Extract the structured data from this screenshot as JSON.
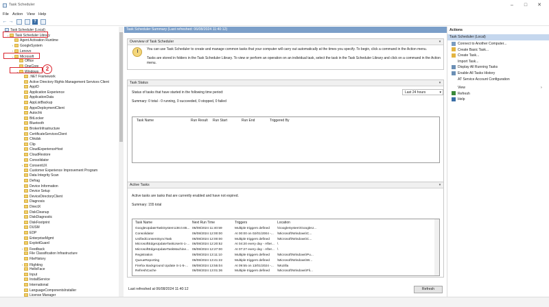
{
  "window": {
    "title": "Task Scheduler"
  },
  "menu": [
    "File",
    "Action",
    "View",
    "Help"
  ],
  "tree": {
    "rows": [
      {
        "label": "Task Scheduler (Local)",
        "indent": 0,
        "arrow": ""
      },
      {
        "label": "Task Scheduler Library",
        "indent": 1,
        "arrow": "v"
      },
      {
        "label": "Agent Activation Runtime",
        "indent": 2,
        "arrow": ""
      },
      {
        "label": "GoogleSystem",
        "indent": 2,
        "arrow": ">"
      },
      {
        "label": "Lenovo",
        "indent": 2,
        "arrow": ">"
      },
      {
        "label": "Microsoft",
        "indent": 2,
        "arrow": "v"
      },
      {
        "label": "Office",
        "indent": 3,
        "arrow": ""
      },
      {
        "label": "OneCore",
        "indent": 3,
        "arrow": ""
      },
      {
        "label": "Windows",
        "indent": 3,
        "arrow": "v"
      },
      {
        "label": ".NET Framework",
        "indent": 4,
        "arrow": ""
      },
      {
        "label": "Active Directory Rights Management Services Client",
        "indent": 4,
        "arrow": ""
      },
      {
        "label": "AppID",
        "indent": 4,
        "arrow": ""
      },
      {
        "label": "Application Experience",
        "indent": 4,
        "arrow": ""
      },
      {
        "label": "ApplicationData",
        "indent": 4,
        "arrow": ""
      },
      {
        "label": "AppListBackup",
        "indent": 4,
        "arrow": ""
      },
      {
        "label": "AppxDeploymentClient",
        "indent": 4,
        "arrow": ""
      },
      {
        "label": "Autochk",
        "indent": 4,
        "arrow": ""
      },
      {
        "label": "BitLocker",
        "indent": 4,
        "arrow": ""
      },
      {
        "label": "Bluetooth",
        "indent": 4,
        "arrow": ""
      },
      {
        "label": "BrokerInfrastructure",
        "indent": 4,
        "arrow": ""
      },
      {
        "label": "CertificateServicesClient",
        "indent": 4,
        "arrow": ""
      },
      {
        "label": "Chkdsk",
        "indent": 4,
        "arrow": ""
      },
      {
        "label": "Clip",
        "indent": 4,
        "arrow": ""
      },
      {
        "label": "CloudExperienceHost",
        "indent": 4,
        "arrow": ""
      },
      {
        "label": "CloudRestore",
        "indent": 4,
        "arrow": ""
      },
      {
        "label": "Consolidator",
        "indent": 4,
        "arrow": ""
      },
      {
        "label": "ConsentUX",
        "indent": 4,
        "arrow": ">"
      },
      {
        "label": "Customer Experience Improvement Program",
        "indent": 4,
        "arrow": ""
      },
      {
        "label": "Data Integrity Scan",
        "indent": 4,
        "arrow": ""
      },
      {
        "label": "Defrag",
        "indent": 4,
        "arrow": ""
      },
      {
        "label": "Device Information",
        "indent": 4,
        "arrow": ""
      },
      {
        "label": "Device Setup",
        "indent": 4,
        "arrow": ""
      },
      {
        "label": "DeviceDirectoryClient",
        "indent": 4,
        "arrow": ""
      },
      {
        "label": "Diagnosis",
        "indent": 4,
        "arrow": ""
      },
      {
        "label": "DirectX",
        "indent": 4,
        "arrow": ""
      },
      {
        "label": "DiskCleanup",
        "indent": 4,
        "arrow": ""
      },
      {
        "label": "DiskDiagnostic",
        "indent": 4,
        "arrow": ""
      },
      {
        "label": "DiskFootprint",
        "indent": 4,
        "arrow": ""
      },
      {
        "label": "DUSM",
        "indent": 4,
        "arrow": ""
      },
      {
        "label": "EDP",
        "indent": 4,
        "arrow": ""
      },
      {
        "label": "EnterpriseMgmt",
        "indent": 4,
        "arrow": ""
      },
      {
        "label": "ExploitGuard",
        "indent": 4,
        "arrow": ""
      },
      {
        "label": "Feedback",
        "indent": 4,
        "arrow": ">"
      },
      {
        "label": "File Classification Infrastructure",
        "indent": 4,
        "arrow": ""
      },
      {
        "label": "FileHistory",
        "indent": 4,
        "arrow": ""
      },
      {
        "label": "Flighting",
        "indent": 4,
        "arrow": ">"
      },
      {
        "label": "HelloFace",
        "indent": 4,
        "arrow": ""
      },
      {
        "label": "Input",
        "indent": 4,
        "arrow": ""
      },
      {
        "label": "InstallService",
        "indent": 4,
        "arrow": ""
      },
      {
        "label": "International",
        "indent": 4,
        "arrow": ""
      },
      {
        "label": "LanguageComponentsInstaller",
        "indent": 4,
        "arrow": ""
      },
      {
        "label": "License Manager",
        "indent": 4,
        "arrow": ""
      }
    ],
    "badge": "2"
  },
  "center": {
    "header": "Task Scheduler Summary (Last refreshed: 06/08/2024 11:40:12)",
    "overview": {
      "title": "Overview of Task Scheduler",
      "line1": "You can use Task Scheduler to create and manage common tasks that your computer will carry out automatically at the times you specify. To begin, click a command in the Action menu.",
      "line2": "Tasks are stored in folders in the Task Scheduler Library. To view or perform an operation on an individual task, select the task in the Task Scheduler Library and click on a command in the Action menu."
    },
    "status": {
      "title": "Task Status",
      "prompt": "Status of tasks that have started in the following time period:",
      "period": "Last 24 hours",
      "summary": "Summary: 0 total - 0 running, 0 succeeded, 0 stopped, 0 failed",
      "columns": [
        "Task Name",
        "Run Result",
        "Run Start",
        "Run End",
        "Triggered By"
      ]
    },
    "active": {
      "title": "Active Tasks",
      "description": "Active tasks are tasks that are currently enabled and have not expired.",
      "summary": "Summary: 155 total",
      "columns": [
        "Task Name",
        "Next Run Time",
        "Triggers",
        "Location"
      ],
      "rows": [
        [
          "GoogleUpdateTaskSystem138.0.65...",
          "06/08/2024 11:40:59",
          "Multiple triggers defined",
          "\\GoogleSystem\\GoogleU..."
        ],
        [
          "Consolidator",
          "06/08/2024 12:00:00",
          "At 00:00 on 02/01/2004 -...",
          "\\Microsoft\\Windows\\C..."
        ],
        [
          "UnifiedConsentSyncTask",
          "06/08/2024 12:00:00",
          "Multiple triggers defined",
          "\\Microsoft\\Windows\\C..."
        ],
        [
          "MicrosoftEdgeUpdateTaskUserS-1-...",
          "06/08/2024 12:20:52",
          "At 04:20 every day - After...",
          "\\"
        ],
        [
          "MicrosoftEdgeUpdateTaskMachine...",
          "06/08/2024 12:27:00",
          "At 07:27 every day - After...",
          "\\"
        ],
        [
          "Registration",
          "06/08/2024 13:11:10",
          "Multiple triggers defined",
          "\\Microsoft\\Windows\\Pu..."
        ],
        [
          "QueueReporting",
          "06/08/2024 13:41:22",
          "Multiple triggers defined",
          "\\Microsoft\\Windows\\W..."
        ],
        [
          "Firefox Background Update S-1-5-...",
          "06/08/2024 13:55:04",
          "At 09:55 on 13/01/2024 -...",
          "\\Mozilla"
        ],
        [
          "RefreshCache",
          "06/08/2024 13:01:36",
          "Multiple triggers defined",
          "\\Microsoft\\Windows\\Fli..."
        ]
      ]
    },
    "footer": "Last refreshed at 06/08/2024 11:40:12",
    "refresh": "Refresh"
  },
  "actions": {
    "title": "Actions",
    "subheader": "Task Scheduler (Local)",
    "items": [
      {
        "label": "Connect to Another Computer...",
        "icon": "computer-icon"
      },
      {
        "label": "Create Basic Task...",
        "icon": "basic-task-icon"
      },
      {
        "label": "Create Task...",
        "icon": "task-icon"
      },
      {
        "label": "Import Task...",
        "icon": ""
      },
      {
        "label": "Display All Running Tasks",
        "icon": "running-tasks-icon"
      },
      {
        "label": "Enable All Tasks History",
        "icon": "history-icon"
      },
      {
        "label": "AT Service Account Configuration",
        "icon": ""
      },
      {
        "label": "View",
        "icon": ""
      },
      {
        "label": "Refresh",
        "icon": "refresh-icon"
      },
      {
        "label": "Help",
        "icon": "help-icon"
      }
    ]
  },
  "colors": {
    "accent": "#7b9fc9",
    "highlight": "#d9232d",
    "folder": "#f1cf6b"
  }
}
